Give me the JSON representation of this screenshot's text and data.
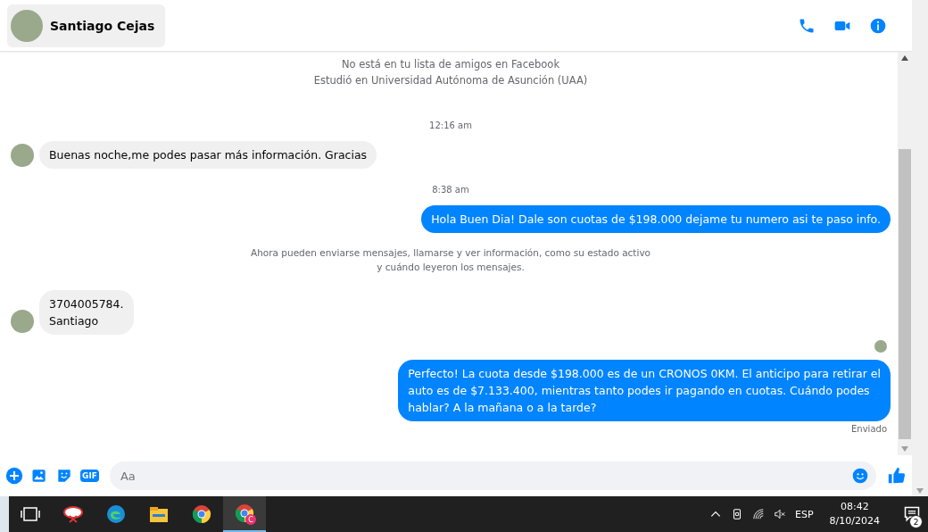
{
  "header": {
    "contact_name": "Santiago Cejas"
  },
  "messages": [
    {
      "kind": "info",
      "lines": [
        "No está en tu lista de amigos en Facebook",
        "Estudió en Universidad Autónoma de Asunción (UAA)"
      ]
    },
    {
      "kind": "time",
      "text": "12:16 am"
    },
    {
      "kind": "incoming",
      "lines": [
        "Buenas noche,me podes pasar más información. Gracias"
      ]
    },
    {
      "kind": "time",
      "text": "8:38 am"
    },
    {
      "kind": "outgoing",
      "lines": [
        "Hola Buen Dia! Dale son cuotas de $198.000 dejame tu numero asi te paso info."
      ]
    },
    {
      "kind": "system",
      "lines": [
        "Ahora pueden enviarse mensajes, llamarse y ver información, como su estado activo",
        "y cuándo leyeron los mensajes."
      ]
    },
    {
      "kind": "incoming",
      "lines": [
        "3704005784.",
        "Santiago"
      ]
    },
    {
      "kind": "seen"
    },
    {
      "kind": "outgoing",
      "lines": [
        "Perfecto! La cuota desde $198.000 es de un CRONOS 0KM. El anticipo para retirar el",
        "auto es de $7.133.400, mientras tanto podes ir pagando en cuotas. Cuándo podes",
        "hablar? A la mañana o a la tarde?"
      ]
    },
    {
      "kind": "status",
      "text": "Enviado"
    }
  ],
  "composer": {
    "gif_label": "GIF",
    "placeholder": "Aa"
  },
  "taskbar": {
    "apps": [
      {
        "kind": "taskview",
        "selected": false
      },
      {
        "kind": "snip",
        "selected": false
      },
      {
        "kind": "edge",
        "selected": false
      },
      {
        "kind": "explorer",
        "selected": false
      },
      {
        "kind": "chrome",
        "selected": false
      },
      {
        "kind": "chrome-profile",
        "selected": true,
        "badge": "C"
      }
    ],
    "language": "ESP",
    "time": "08:42",
    "date": "8/10/2024",
    "notification_count": "2"
  }
}
